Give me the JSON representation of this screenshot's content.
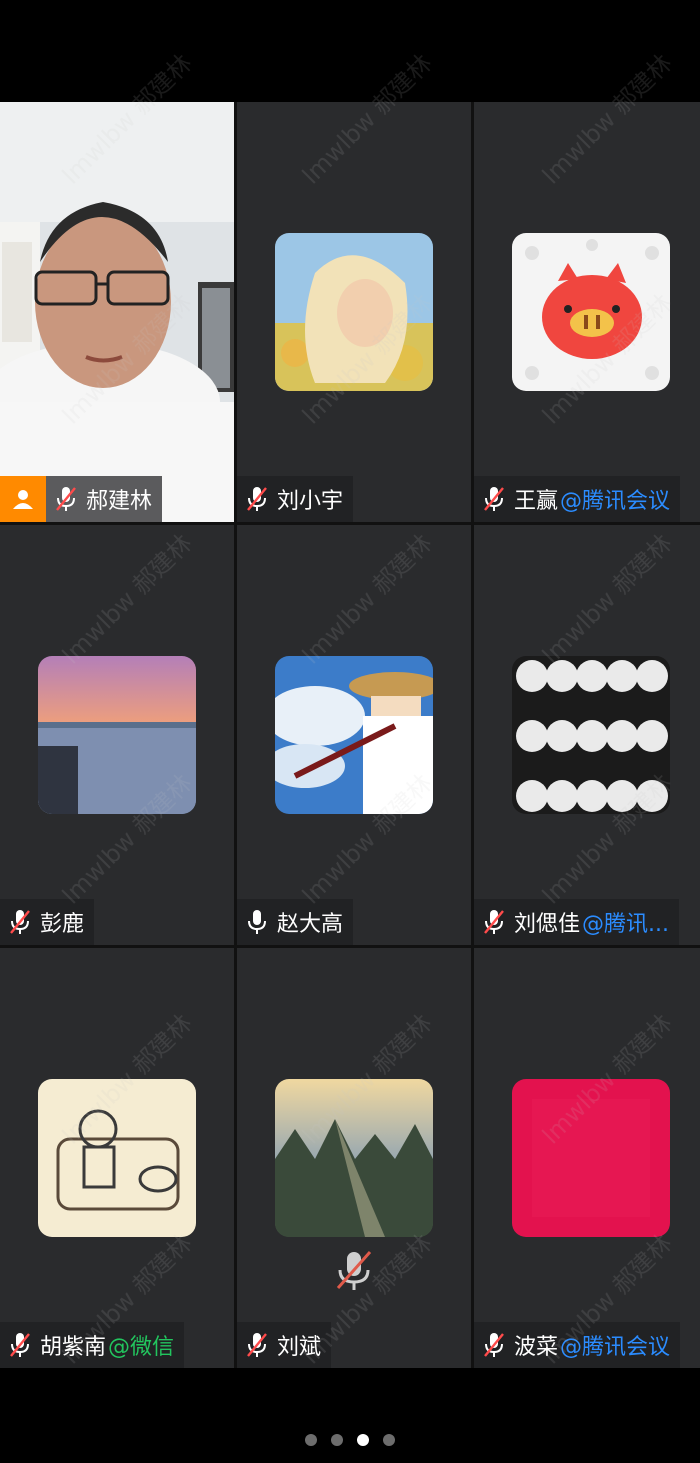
{
  "participants": [
    {
      "name": "郝建林",
      "source": "",
      "source_color": "",
      "mic": "muted",
      "host": true
    },
    {
      "name": "刘小宇",
      "source": "",
      "source_color": "",
      "mic": "muted"
    },
    {
      "name": "王赢",
      "source": "@腾讯会议",
      "source_color": "blue",
      "mic": "muted"
    },
    {
      "name": "彭鹿",
      "source": "",
      "source_color": "",
      "mic": "muted"
    },
    {
      "name": "赵大高",
      "source": "",
      "source_color": "",
      "mic": "on"
    },
    {
      "name": "刘偲佳",
      "source": "@腾讯...",
      "source_color": "blue",
      "mic": "muted"
    },
    {
      "name": "胡紫南",
      "source": "@微信",
      "source_color": "green",
      "mic": "muted"
    },
    {
      "name": "刘斌",
      "source": "",
      "source_color": "",
      "mic": "muted"
    },
    {
      "name": "波菜",
      "source": "@腾讯会议",
      "source_color": "blue",
      "mic": "muted"
    }
  ],
  "watermark": "lmwlbw 郝建林",
  "pager": {
    "pages": 4,
    "current": 3
  },
  "colors": {
    "tile_bg": "#2a2b2d",
    "host_badge": "#ff8a00",
    "tencent_blue": "#2b8cff",
    "wechat_green": "#22c55e"
  }
}
